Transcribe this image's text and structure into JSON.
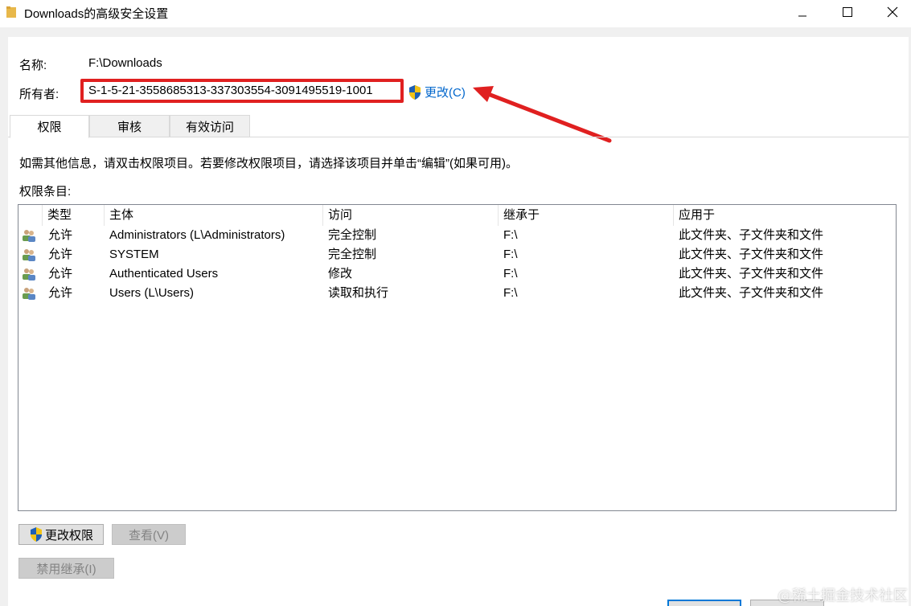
{
  "window": {
    "title": "Downloads的高级安全设置"
  },
  "name_label": "名称:",
  "name_value": "F:\\Downloads",
  "owner_label": "所有者:",
  "owner_value": "S-1-5-21-3558685313-337303554-3091495519-1001",
  "change_link": "更改(C)",
  "tabs": [
    {
      "label": "权限",
      "active": true
    },
    {
      "label": "审核",
      "active": false
    },
    {
      "label": "有效访问",
      "active": false
    }
  ],
  "info_text": "如需其他信息，请双击权限项目。若要修改权限项目，请选择该项目并单击“编辑”(如果可用)。",
  "entries_label": "权限条目:",
  "columns": [
    "类型",
    "主体",
    "访问",
    "继承于",
    "应用于"
  ],
  "rows": [
    {
      "type": "允许",
      "principal": "Administrators (L\\Administrators)",
      "access": "完全控制",
      "inherited": "F:\\",
      "applies": "此文件夹、子文件夹和文件"
    },
    {
      "type": "允许",
      "principal": "SYSTEM",
      "access": "完全控制",
      "inherited": "F:\\",
      "applies": "此文件夹、子文件夹和文件"
    },
    {
      "type": "允许",
      "principal": "Authenticated Users",
      "access": "修改",
      "inherited": "F:\\",
      "applies": "此文件夹、子文件夹和文件"
    },
    {
      "type": "允许",
      "principal": "Users (L\\Users)",
      "access": "读取和执行",
      "inherited": "F:\\",
      "applies": "此文件夹、子文件夹和文件"
    }
  ],
  "buttons": {
    "change_permissions": "更改权限",
    "view": "查看(V)",
    "disable_inheritance": "禁用继承(I)"
  },
  "watermark": "@稀土掘金技术社区",
  "colors": {
    "highlight_box": "#e02020",
    "link": "#0066cc"
  }
}
